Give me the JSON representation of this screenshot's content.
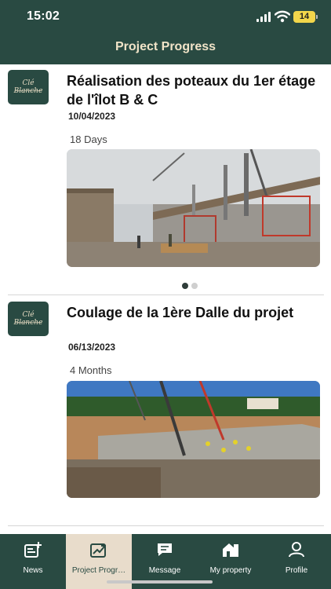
{
  "status_bar": {
    "time": "15:02",
    "battery": "14"
  },
  "header": {
    "title": "Project Progress"
  },
  "brand": {
    "logo_text": "Clé Blanche"
  },
  "posts": [
    {
      "title": "Réalisation des poteaux du 1er étage de l'îlot B & C",
      "date": "10/04/2023",
      "duration": "18 Days"
    },
    {
      "title": "Coulage de la 1ère Dalle du projet",
      "date": "06/13/2023",
      "duration": "4 Months"
    }
  ],
  "carousel": {
    "count": 2,
    "active_index": 0
  },
  "nav": {
    "items": [
      {
        "label": "News",
        "icon": "news-icon"
      },
      {
        "label": "Project Progr…",
        "icon": "progress-chart-icon"
      },
      {
        "label": "Message",
        "icon": "message-icon"
      },
      {
        "label": "My property",
        "icon": "property-icon"
      },
      {
        "label": "Profile",
        "icon": "profile-icon"
      }
    ],
    "active_index": 1
  },
  "colors": {
    "primary": "#294a42",
    "accent": "#f1e4c8",
    "active_tab": "#e8dccb",
    "battery": "#f2d64b"
  }
}
